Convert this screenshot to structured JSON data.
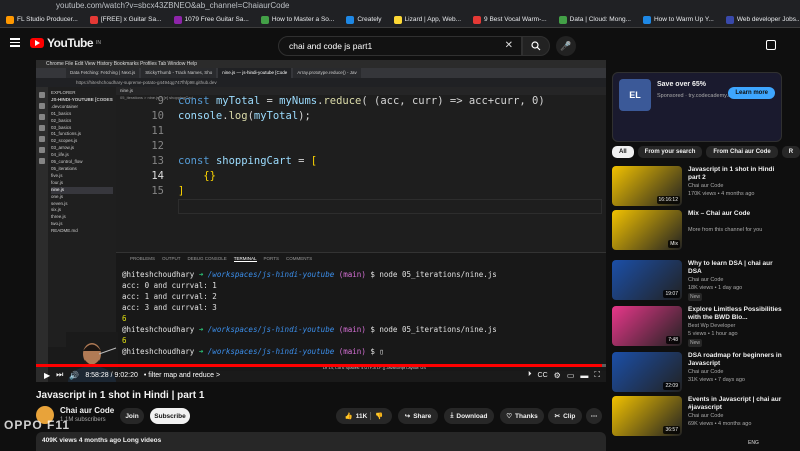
{
  "browser": {
    "url": "youtube.com/watch?v=sbcx43ZBNEO&ab_channel=ChaiaurCode",
    "bookmarks": [
      "FL Studio Producer...",
      "[FREE] x Guitar Sa...",
      "1079 Free Guitar Sa...",
      "How to Master a So...",
      "Creately",
      "Lizard | App, Web...",
      "9 Best Vocal Warm-...",
      "Data | Cloud: Mong...",
      "How to Warm Up Y...",
      "Web developer Jobs...",
      "Home | Myntraa"
    ]
  },
  "youtube": {
    "logo": "YouTube",
    "country": "IN",
    "search_value": "chai and code js part1"
  },
  "video": {
    "mac_menu": "Chrome  File  Edit  View  History  Bookmarks  Profiles  Tab  Window  Help",
    "inner_tabs": [
      "Data Fetching: Fetching | Next.js",
      "StickyThumb - Track Names, Sho",
      "nine.js — js-hindi-youtube [Code",
      "Array.prototype.reduce() - Jav"
    ],
    "inner_url": "https://hiteshchoudhary-supreme-potato-g4494qg747fhfp98.github.dev",
    "explorer": {
      "header": "EXPLORER",
      "root": "JS-HINDI-YOUTUBE [CODESPACES]",
      "items": [
        ".devcontainer",
        "01_basics",
        "02_basics",
        "03_basics",
        "01_functions.js",
        "02_scopes.js",
        "03_arrow.js",
        "04_iife.js",
        "05_control_flow",
        "05_iterations",
        "five.js",
        "four.js",
        "nine.js",
        "one.js",
        "seven.js",
        "six.js",
        "three.js",
        "two.js",
        "README.md"
      ],
      "selected_index": 12
    },
    "editor": {
      "tab": "nine.js",
      "breadcrumb": "05_iterations > nine.js > [e] shoppingCart",
      "lines": [
        {
          "n": "9",
          "parts": [
            [
              "kw",
              "const "
            ],
            [
              "vr",
              "myTotal"
            ],
            [
              "pu",
              " = "
            ],
            [
              "vr",
              "myNums"
            ],
            [
              "pu",
              "."
            ],
            [
              "fn",
              "reduce"
            ],
            [
              "pu",
              "( (acc, curr) => acc+curr, 0)"
            ]
          ]
        },
        {
          "n": "10",
          "parts": [
            [
              "vr",
              "console"
            ],
            [
              "pu",
              "."
            ],
            [
              "fn",
              "log"
            ],
            [
              "pu",
              "("
            ],
            [
              "vr",
              "myTotal"
            ],
            [
              "pu",
              ");"
            ]
          ]
        },
        {
          "n": "11",
          "parts": []
        },
        {
          "n": "12",
          "parts": []
        },
        {
          "n": "13",
          "parts": [
            [
              "kw",
              "const "
            ],
            [
              "vr",
              "shoppingCart"
            ],
            [
              "pu",
              " = "
            ],
            [
              "br",
              "["
            ]
          ]
        },
        {
          "n": "14",
          "parts": [
            [
              "pu",
              "    "
            ],
            [
              "br",
              "{}"
            ]
          ]
        },
        {
          "n": "15",
          "parts": [
            [
              "br",
              "]"
            ]
          ]
        }
      ]
    },
    "panel_tabs": [
      "PROBLEMS",
      "OUTPUT",
      "DEBUG CONSOLE",
      "TERMINAL",
      "PORTS",
      "COMMENTS"
    ],
    "active_panel_tab": "TERMINAL",
    "terminal": {
      "user": "@hiteshchoudhary",
      "arrow": "➜",
      "path": "/workspaces/js-hindi-youtube",
      "branch": "(main)",
      "cmd": "$ node 05_iterations/nine.js",
      "out1": [
        "acc: 0 and currval: 1",
        "acc: 1 and currval: 2",
        "acc: 3 and currval: 3"
      ],
      "result1": "6",
      "result2": "6",
      "prompt_end": "$"
    },
    "statusbar": "Ln 14, Col 6   Spaces: 4   UTF-8   LF   {} JavaScript   Layout: US",
    "time": "8:58:28 / 9:02:20",
    "chapter": "• filter map and reduce >",
    "progress": 0.993
  },
  "meta": {
    "title": "Javascript in 1 shot in Hindi | part 1",
    "channel": "Chai aur Code",
    "subscribers": "1.1M subscribers",
    "join": "Join",
    "subscribe": "Subscribe",
    "likes": "11K",
    "share": "Share",
    "download": "Download",
    "thanks": "Thanks",
    "clip": "Clip",
    "views": "409K views  4 months ago  Long videos"
  },
  "sidebar": {
    "ad": {
      "logo": "EL",
      "title": "Save over 65%",
      "sponsored": "Sponsored · try.codecademy.com",
      "cta": "Learn more"
    },
    "chips": [
      "All",
      "From your search",
      "From Chai aur Code",
      "R"
    ],
    "recs": [
      {
        "title": "Javascript in 1 shot in Hindi part 2",
        "channel": "Chai aur Code",
        "meta": "170K views • 4 months ago",
        "dur": "16:16:12",
        "color": "#f2c200"
      },
      {
        "title": "Mix – Chai aur Code",
        "channel": "More from this channel for you",
        "meta": "",
        "dur": "Mix",
        "color": "#f2c200"
      },
      {
        "title": "Why to learn DSA | chai aur DSA",
        "channel": "Chai aur Code",
        "meta": "18K views • 1 day ago",
        "dur": "19:07",
        "color": "#1b4fa8",
        "badge": "New"
      },
      {
        "title": "Explore Limitless Possibilities with the BWD Blo...",
        "channel": "Best Wp Developer",
        "meta": "5 views • 1 hour ago",
        "dur": "7:48",
        "color": "#e8378a",
        "badge": "New"
      },
      {
        "title": "DSA roadmap for beginners in Javascript",
        "channel": "Chai aur Code",
        "meta": "31K views • 7 days ago",
        "dur": "22:09",
        "color": "#1b4fa8"
      },
      {
        "title": "Events in Javascript | chai aur #javascript",
        "channel": "Chai aur Code",
        "meta": "69K views • 4 months ago",
        "dur": "36:57",
        "color": "#f2c200"
      }
    ]
  },
  "watermark": "OPPO F11",
  "taskbar": "ENG",
  "colors": {
    "accent": "#ff0000",
    "link": "#3ea6ff"
  }
}
